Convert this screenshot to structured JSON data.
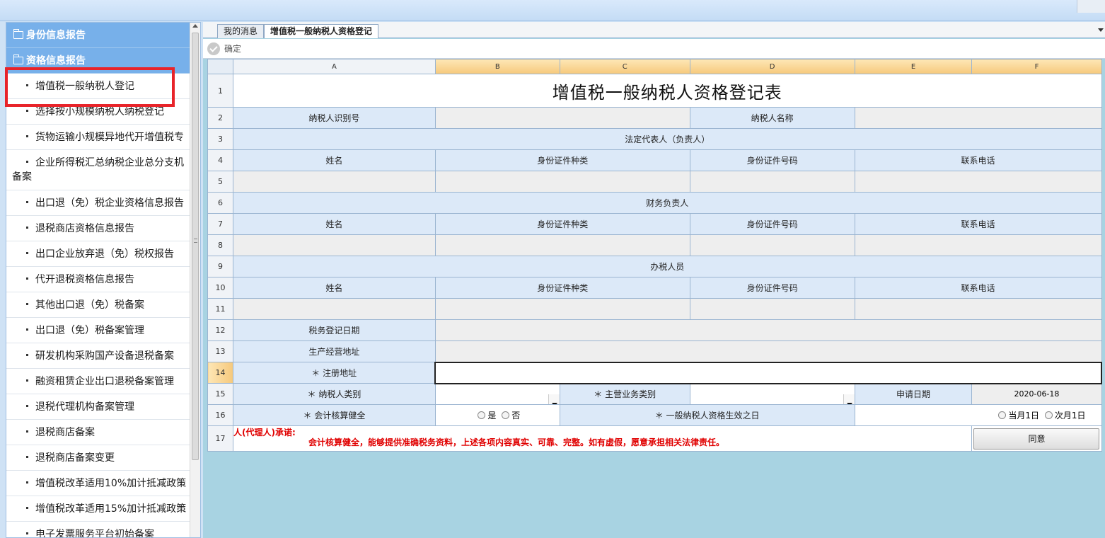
{
  "sidebar": {
    "headers": [
      {
        "label": "身份信息报告"
      },
      {
        "label": "资格信息报告"
      }
    ],
    "items": [
      {
        "label": "增值税一般纳税人登记"
      },
      {
        "label": "选择按小规模纳税人纳税登记"
      },
      {
        "label": "货物运输小规模异地代开增值税专"
      },
      {
        "label": "企业所得税汇总纳税企业总分支机备案"
      },
      {
        "label": "出口退（免）税企业资格信息报告"
      },
      {
        "label": "退税商店资格信息报告"
      },
      {
        "label": "出口企业放弃退（免）税权报告"
      },
      {
        "label": "代开退税资格信息报告"
      },
      {
        "label": "其他出口退（免）税备案"
      },
      {
        "label": "出口退（免）税备案管理"
      },
      {
        "label": "研发机构采购国产设备退税备案"
      },
      {
        "label": "融资租赁企业出口退税备案管理"
      },
      {
        "label": "退税代理机构备案管理"
      },
      {
        "label": "退税商店备案"
      },
      {
        "label": "退税商店备案变更"
      },
      {
        "label": "增值税改革适用10%加计抵减政策"
      },
      {
        "label": "增值税改革适用15%加计抵减政策"
      },
      {
        "label": "电子发票服务平台初始备案"
      }
    ]
  },
  "tabs": [
    {
      "label": "我的消息"
    },
    {
      "label": "增值税一般纳税人资格登记"
    }
  ],
  "toolbar": {
    "confirm_label": "确定"
  },
  "sheet": {
    "columns": [
      "A",
      "B",
      "C",
      "D",
      "E",
      "F"
    ],
    "rows": [
      "1",
      "2",
      "3",
      "4",
      "5",
      "6",
      "7",
      "8",
      "9",
      "10",
      "11",
      "12",
      "13",
      "14",
      "15",
      "16",
      "17"
    ],
    "title": "增值税一般纳税人资格登记表",
    "taxpayer_id_label": "纳税人识别号",
    "taxpayer_name_label": "纳税人名称",
    "legal_rep_label": "法定代表人（负责人）",
    "finance_label": "财务负责人",
    "handler_label": "办税人员",
    "col_name": "姓名",
    "col_id_type": "身份证件种类",
    "col_id_no": "身份证件号码",
    "col_phone": "联系电话",
    "tax_reg_date_label": "税务登记日期",
    "business_addr_label": "生产经营地址",
    "reg_addr_label": "＊ 注册地址",
    "taxpayer_type_label": "＊ 纳税人类别",
    "main_business_label": "＊ 主营业务类别",
    "apply_date_label": "申请日期",
    "apply_date_value": "2020-06-18",
    "accounting_label": "＊ 会计核算健全",
    "yes_label": "是",
    "no_label": "否",
    "effective_label": "＊ 一般纳税人资格生效之日",
    "current_month_label": "当月1日",
    "next_month_label": "次月1日",
    "promise_prefix": "人(代理人)承诺:",
    "promise_text": "会计核算健全，能够提供准确税务资料，上述各项内容真实、可靠、完整。如有虚假，愿意承担相关法律责任。",
    "agree_label": "同意"
  }
}
